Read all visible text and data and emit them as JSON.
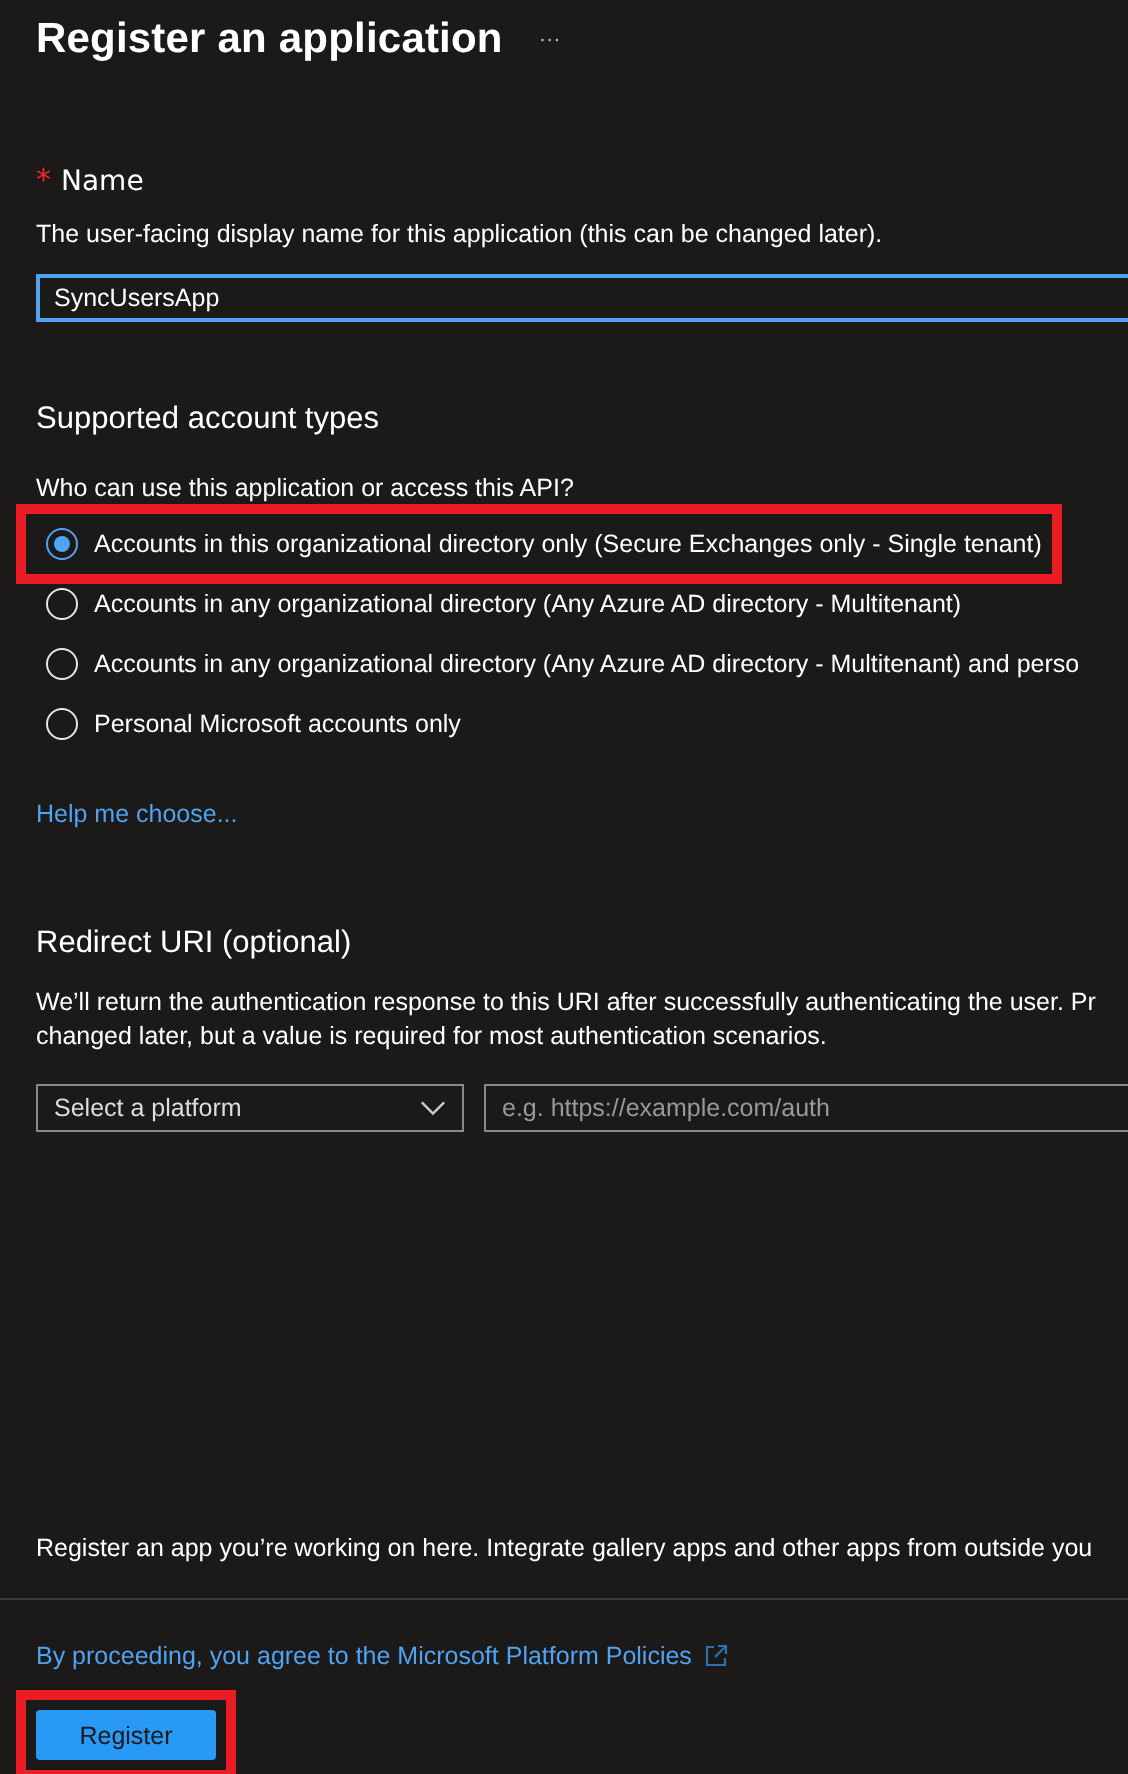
{
  "header": {
    "title": "Register an application",
    "more": "···"
  },
  "name_field": {
    "label": "Name",
    "required_mark": "*",
    "description": "The user-facing display name for this application (this can be changed later).",
    "value": "SyncUsersApp",
    "focused": true
  },
  "account_types": {
    "heading": "Supported account types",
    "question": "Who can use this application or access this API?",
    "options": [
      {
        "label": "Accounts in this organizational directory only (Secure Exchanges only - Single tenant)",
        "selected": true,
        "highlighted": true
      },
      {
        "label": "Accounts in any organizational directory (Any Azure AD directory - Multitenant)",
        "selected": false,
        "highlighted": false
      },
      {
        "label": "Accounts in any organizational directory (Any Azure AD directory - Multitenant) and perso",
        "selected": false,
        "highlighted": false
      },
      {
        "label": "Personal Microsoft accounts only",
        "selected": false,
        "highlighted": false
      }
    ],
    "help_link": "Help me choose..."
  },
  "redirect": {
    "heading": "Redirect URI (optional)",
    "description_lines": [
      "We’ll return the authentication response to this URI after successfully authenticating the user. Pr",
      "changed later, but a value is required for most authentication scenarios."
    ],
    "platform": "Select a platform",
    "uri_placeholder": "e.g. https://example.com/auth"
  },
  "footer": {
    "note": "Register an app you’re working on here. Integrate gallery apps and other apps from outside you",
    "policy_link": "By proceeding, you agree to the Microsoft Platform Policies",
    "button": {
      "label": "Register",
      "highlighted": true
    }
  }
}
